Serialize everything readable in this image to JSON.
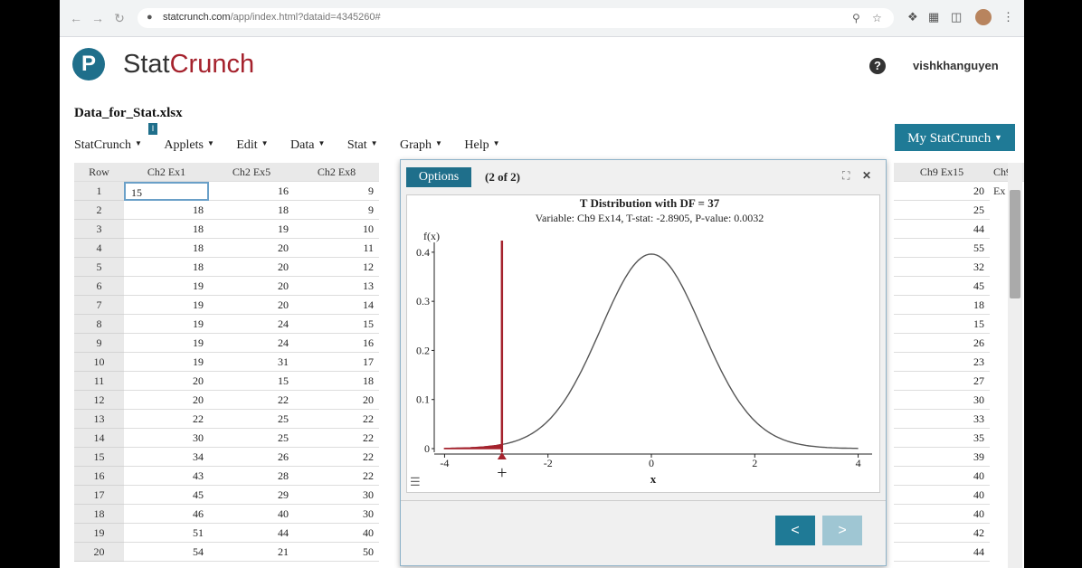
{
  "browser": {
    "url_host": "statcrunch.com",
    "url_path": "/app/index.html?dataid=4345260#"
  },
  "header": {
    "brand_part1": "Stat",
    "brand_part2": "Crunch",
    "username": "vishkhanguyen",
    "help_icon": "question-circle-icon"
  },
  "file": {
    "name": "Data_for_Stat.xlsx"
  },
  "menu": [
    "StatCrunch",
    "Applets",
    "Edit",
    "Data",
    "Stat",
    "Graph",
    "Help"
  ],
  "my_statcrunch": "My StatCrunch",
  "grid": {
    "row_header": "Row",
    "columns_left": [
      "Ch2 Ex1",
      "Ch2 Ex5",
      "Ch2 Ex8"
    ],
    "columns_right": [
      "Ch9 Ex15",
      "Ch9 Ex"
    ],
    "rows": [
      {
        "n": "1",
        "c1": "15",
        "c2": "16",
        "c3": "9",
        "r": "20"
      },
      {
        "n": "2",
        "c1": "18",
        "c2": "18",
        "c3": "9",
        "r": "25"
      },
      {
        "n": "3",
        "c1": "18",
        "c2": "19",
        "c3": "10",
        "r": "44"
      },
      {
        "n": "4",
        "c1": "18",
        "c2": "20",
        "c3": "11",
        "r": "55"
      },
      {
        "n": "5",
        "c1": "18",
        "c2": "20",
        "c3": "12",
        "r": "32"
      },
      {
        "n": "6",
        "c1": "19",
        "c2": "20",
        "c3": "13",
        "r": "45"
      },
      {
        "n": "7",
        "c1": "19",
        "c2": "20",
        "c3": "14",
        "r": "18"
      },
      {
        "n": "8",
        "c1": "19",
        "c2": "24",
        "c3": "15",
        "r": "15"
      },
      {
        "n": "9",
        "c1": "19",
        "c2": "24",
        "c3": "16",
        "r": "26"
      },
      {
        "n": "10",
        "c1": "19",
        "c2": "31",
        "c3": "17",
        "r": "23"
      },
      {
        "n": "11",
        "c1": "20",
        "c2": "15",
        "c3": "18",
        "r": "27"
      },
      {
        "n": "12",
        "c1": "20",
        "c2": "22",
        "c3": "20",
        "r": "30"
      },
      {
        "n": "13",
        "c1": "22",
        "c2": "25",
        "c3": "22",
        "r": "33"
      },
      {
        "n": "14",
        "c1": "30",
        "c2": "25",
        "c3": "22",
        "r": "35"
      },
      {
        "n": "15",
        "c1": "34",
        "c2": "26",
        "c3": "22",
        "r": "39"
      },
      {
        "n": "16",
        "c1": "43",
        "c2": "28",
        "c3": "22",
        "r": "40"
      },
      {
        "n": "17",
        "c1": "45",
        "c2": "29",
        "c3": "30",
        "r": "40"
      },
      {
        "n": "18",
        "c1": "46",
        "c2": "40",
        "c3": "30",
        "r": "40"
      },
      {
        "n": "19",
        "c1": "51",
        "c2": "44",
        "c3": "40",
        "r": "42"
      },
      {
        "n": "20",
        "c1": "54",
        "c2": "21",
        "c3": "50",
        "r": "44"
      }
    ]
  },
  "dialog": {
    "options_label": "Options",
    "pager": "(2 of 2)",
    "prev_label": "<",
    "next_label": ">"
  },
  "chart_data": {
    "type": "line",
    "title": "T Distribution with DF = 37",
    "subtitle": "Variable: Ch9 Ex14, T-stat: -2.8905, P-value: 0.0032",
    "xlabel": "x",
    "ylabel": "f(x)",
    "df": 37,
    "t_stat": -2.8905,
    "p_value": 0.0032,
    "xlim": [
      -4.2,
      4.2
    ],
    "ylim": [
      0,
      0.42
    ],
    "x_ticks": [
      "-4",
      "-2",
      "0",
      "2",
      "4"
    ],
    "y_ticks": [
      "0",
      "0.1",
      "0.2",
      "0.3",
      "0.4"
    ],
    "curve_color": "#555555",
    "shade_color": "#a5222d",
    "shaded_region": "left tail, x < -2.8905"
  }
}
